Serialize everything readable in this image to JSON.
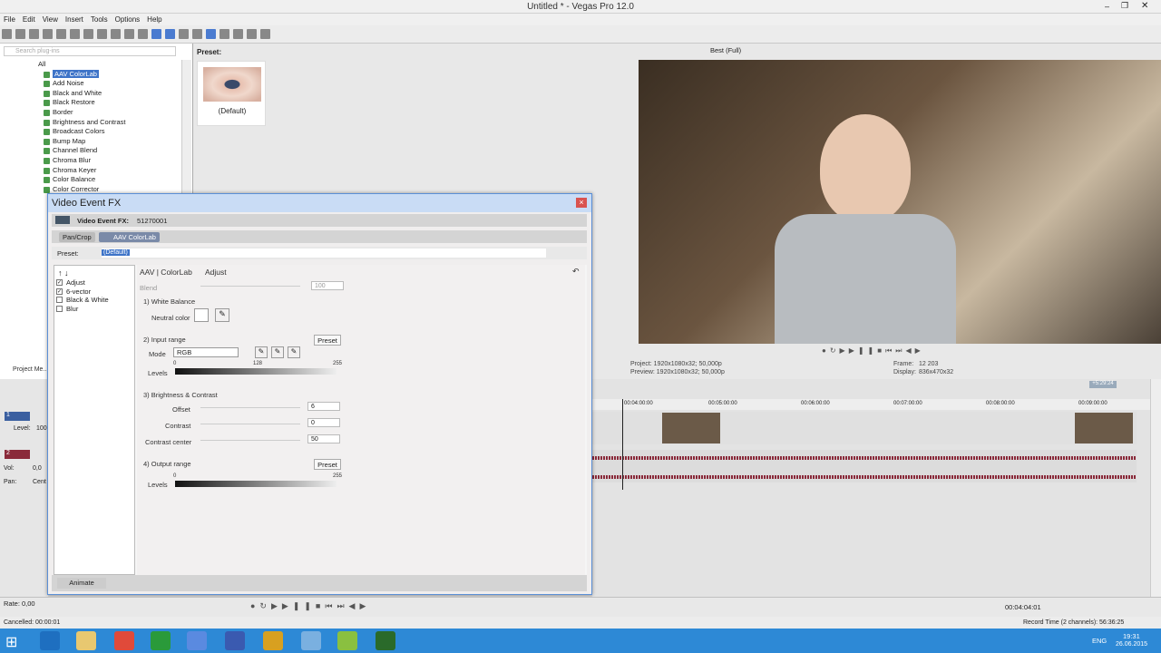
{
  "app": {
    "title": "Untitled * - Vegas Pro 12.0"
  },
  "menu": [
    "File",
    "Edit",
    "View",
    "Insert",
    "Tools",
    "Options",
    "Help"
  ],
  "plugins": {
    "search_placeholder": "Search plug-ins",
    "root": "All",
    "items": [
      "AAV ColorLab",
      "Add Noise",
      "Black and White",
      "Black Restore",
      "Border",
      "Brightness and Contrast",
      "Broadcast Colors",
      "Bump Map",
      "Channel Blend",
      "Chroma Blur",
      "Chroma Keyer",
      "Color Balance",
      "Color Corrector"
    ],
    "selected": "AAV ColorLab",
    "preset_header": "Preset:",
    "preset_default": "(Default)",
    "project_media_tab": "Project Me..."
  },
  "preview": {
    "quality": "Best (Full)",
    "project": "Project:  1920x1080x32; 50,000p",
    "preview": "Preview:  1920x1080x32; 50,000p",
    "frame": "Frame:",
    "frame_val": "12 203",
    "display": "Display:",
    "display_val": "836x470x32"
  },
  "timeline": {
    "ticks": [
      "00:04:00:00",
      "00:05:00:00",
      "00:06:00:00",
      "00:07:00:00",
      "00:08:00:00",
      "00:09:00:00"
    ],
    "time_marker": "+5:29:24"
  },
  "tracks": {
    "vol_label": "Vol:",
    "vol_val": "0,0",
    "pan_label": "Pan:",
    "pan_val": "Cent",
    "level_label": "Level:",
    "level_val": "100",
    "t1": "1",
    "t2": "2"
  },
  "fx": {
    "title": "Video Event FX",
    "head_label": "Video Event FX:",
    "head_id": "51270001",
    "chain": [
      "Pan/Crop",
      "AAV ColorLab"
    ],
    "preset_label": "Preset:",
    "preset_value": "(Default)",
    "list": [
      {
        "label": "Adjust",
        "checked": "✓"
      },
      {
        "label": "6-vector",
        "checked": "✓"
      },
      {
        "label": "Black & White",
        "checked": ""
      },
      {
        "label": "Blur",
        "checked": ""
      }
    ],
    "header": "AAV | ColorLab",
    "tab": "Adjust",
    "blend_label": "Blend",
    "blend_val": "100",
    "wb_title": "1) White Balance",
    "neutral_label": "Neutral color",
    "input_title": "2) Input range",
    "preset_btn": "Preset",
    "mode_label": "Mode",
    "mode_val": "RGB",
    "levels_label": "Levels",
    "lv0": "0",
    "lv128": "128",
    "lv255": "255",
    "bc_title": "3) Brightness & Contrast",
    "offset_label": "Offset",
    "offset_val": "6",
    "contrast_label": "Contrast",
    "contrast_val": "0",
    "cc_label": "Contrast center",
    "cc_val": "50",
    "output_title": "4) Output range",
    "animate": "Animate"
  },
  "transport": {
    "rate": "Rate: 0,00",
    "timecode": "00:04:04:01"
  },
  "status": {
    "left": "Cancelled: 00:00:01",
    "right": "Record Time (2 channels): 56:36:25"
  },
  "taskbar": {
    "lang": "ENG",
    "time": "19:31",
    "date": "26.06.2015"
  }
}
